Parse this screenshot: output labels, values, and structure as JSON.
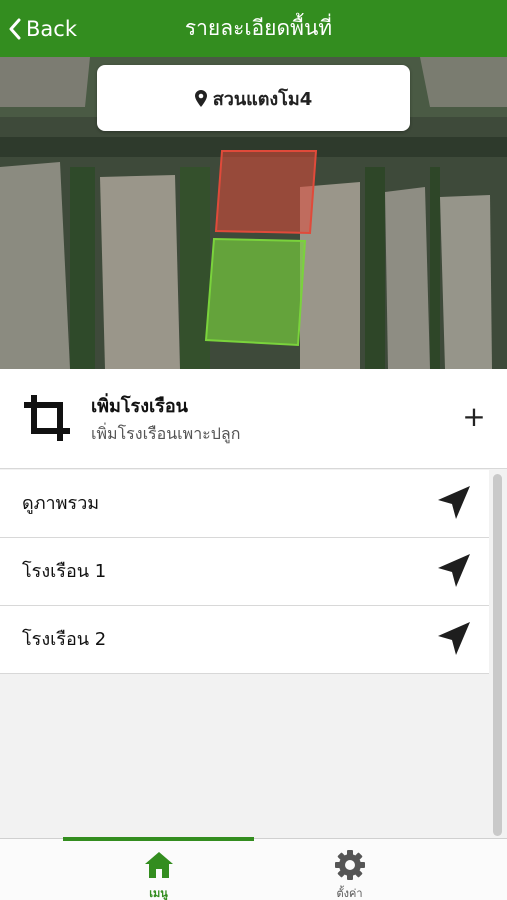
{
  "header": {
    "back_label": "Back",
    "title": "รายละเอียดพื้นที่"
  },
  "map": {
    "location_name": "สวนแตงโม4",
    "zones": [
      {
        "color": "#e04a3a",
        "state": "red"
      },
      {
        "color": "#7ad33c",
        "state": "green"
      }
    ]
  },
  "add_greenhouse": {
    "title": "เพิ่มโรงเรือน",
    "subtitle": "เพิ่มโรงเรือนเพาะปลูก",
    "action_icon": "plus-icon"
  },
  "list": {
    "items": [
      {
        "label": "ดูภาพรวม",
        "icon": "navigation-arrow-icon"
      },
      {
        "label": "โรงเรือน 1",
        "icon": "navigation-arrow-icon"
      },
      {
        "label": "โรงเรือน 2",
        "icon": "navigation-arrow-icon"
      }
    ]
  },
  "tabs": {
    "menu_label": "เมนู",
    "settings_label": "ตั้งค่า",
    "active": "menu"
  },
  "colors": {
    "primary": "#338d1f",
    "background": "#f2f2f2"
  }
}
